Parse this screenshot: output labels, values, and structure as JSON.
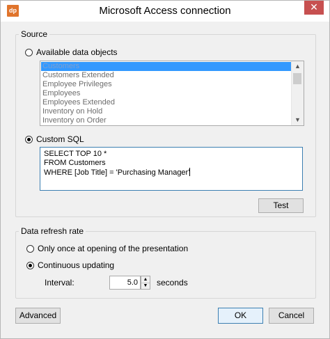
{
  "window": {
    "title": "Microsoft Access connection",
    "app_icon_text": "dp",
    "close_glyph": "✕"
  },
  "source": {
    "legend": "Source",
    "available_label": "Available data objects",
    "available_checked": false,
    "list_items": [
      "Customers",
      "Customers Extended",
      "Employee Privileges",
      "Employees",
      "Employees Extended",
      "Inventory on Hold",
      "Inventory on Order"
    ],
    "selected_index": 0,
    "custom_sql_label": "Custom SQL",
    "custom_sql_checked": true,
    "sql_lines": [
      "SELECT TOP 10 *",
      "FROM Customers",
      "WHERE [Job Title] = 'Purchasing Manager'"
    ],
    "test_label": "Test"
  },
  "refresh": {
    "legend": "Data refresh rate",
    "once_label": "Only once at opening of the presentation",
    "once_checked": false,
    "continuous_label": "Continuous updating",
    "continuous_checked": true,
    "interval_label": "Interval:",
    "interval_value": "5.0",
    "interval_unit": "seconds"
  },
  "footer": {
    "advanced_label": "Advanced",
    "ok_label": "OK",
    "cancel_label": "Cancel"
  },
  "colors": {
    "selection": "#3399ff",
    "close_button": "#c75050",
    "app_icon": "#e0742c",
    "focus_border": "#3c7fb1"
  }
}
